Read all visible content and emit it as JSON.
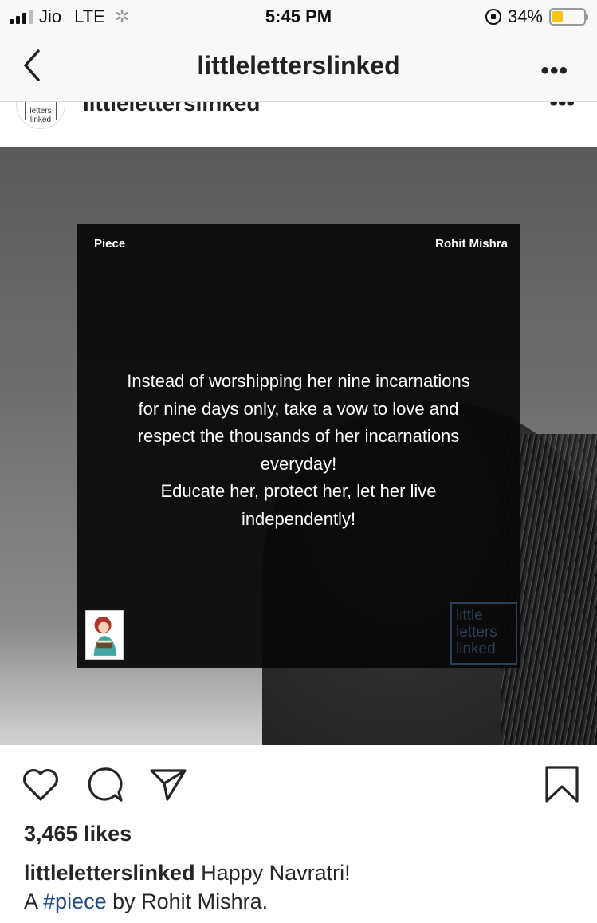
{
  "status_bar": {
    "carrier": "Jio",
    "network": "LTE",
    "time": "5:45 PM",
    "battery_percent": "34%",
    "battery_level": 0.34
  },
  "nav": {
    "title": "littleletterslinked"
  },
  "post": {
    "username": "littleletterslinked",
    "avatar_text": "letters linked",
    "image": {
      "card_left_label": "Piece",
      "card_right_label": "Rohit Mishra",
      "quote_lines": [
        "Instead of worshipping her nine incarnations",
        "for nine days only, take a vow to love and",
        "respect the thousands of her incarnations",
        "everyday!",
        "Educate her, protect her, let her live",
        "independently!"
      ],
      "logo_lines": [
        "little",
        "letters",
        "linked"
      ]
    },
    "likes": "3,465 likes",
    "caption": {
      "username": "littleletterslinked",
      "text": "Happy Navratri!",
      "line2_prefix": "A ",
      "line2_hashtag": "#piece",
      "line2_suffix": " by Rohit Mishra."
    }
  },
  "colors": {
    "hashtag": "#1f4c86",
    "battery_fill": "#f5c518",
    "logo": "#2b3d58"
  },
  "icons": [
    "signal-icon",
    "loading-spinner-icon",
    "rotation-lock-icon",
    "battery-icon",
    "back-chevron-icon",
    "more-options-icon",
    "heart-icon",
    "comment-icon",
    "share-icon",
    "bookmark-icon"
  ]
}
